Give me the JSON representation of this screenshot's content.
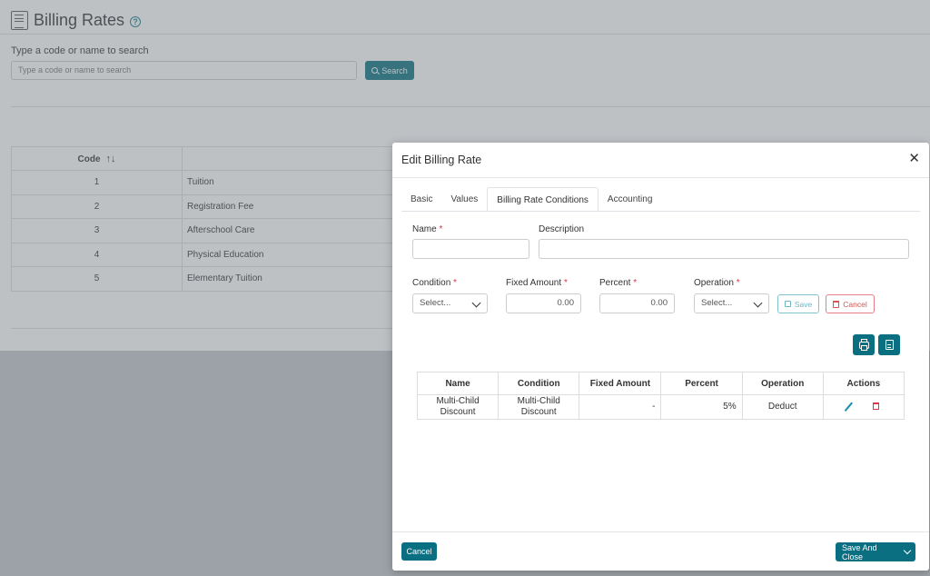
{
  "page": {
    "title": "Billing Rates",
    "search_label": "Type a code or name to search",
    "search_placeholder": "Type a code or name to search",
    "search_button": "Search",
    "table": {
      "code_header": "Code",
      "rows": [
        {
          "code": "1",
          "name": "Tuition"
        },
        {
          "code": "2",
          "name": "Registration Fee"
        },
        {
          "code": "3",
          "name": "Afterschool Care"
        },
        {
          "code": "4",
          "name": "Physical Education"
        },
        {
          "code": "5",
          "name": "Elementary Tuition"
        }
      ]
    }
  },
  "modal": {
    "title": "Edit Billing Rate",
    "close": "✕",
    "tabs": [
      "Basic",
      "Values",
      "Billing Rate Conditions",
      "Accounting"
    ],
    "active_tab": "Billing Rate Conditions",
    "form": {
      "name_label": "Name",
      "description_label": "Description",
      "condition_label": "Condition",
      "condition_value": "Select...",
      "fixed_amount_label": "Fixed Amount",
      "fixed_amount_value": "0.00",
      "percent_label": "Percent",
      "percent_value": "0.00",
      "operation_label": "Operation",
      "operation_value": "Select...",
      "required_mark": "*",
      "save_label": "Save",
      "cancel_label": "Cancel"
    },
    "conditions_table": {
      "headers": [
        "Name",
        "Condition",
        "Fixed Amount",
        "Percent",
        "Operation",
        "Actions"
      ],
      "rows": [
        {
          "name_line1": "Multi-Child",
          "name_line2": "Discount",
          "condition_line1": "Multi-Child",
          "condition_line2": "Discount",
          "fixed_amount": "-",
          "percent": "5%",
          "operation": "Deduct"
        }
      ]
    },
    "footer": {
      "cancel": "Cancel",
      "save_and_close": "Save And Close"
    }
  },
  "colors": {
    "primary": "#0b6f82",
    "danger": "#dc3545",
    "overlay": "#6c757d"
  },
  "icons": [
    "logo-icon",
    "help-icon",
    "search-icon",
    "sort-icon",
    "close-icon",
    "chevron-down-icon",
    "save-icon",
    "trash-icon",
    "printer-icon",
    "document-icon",
    "pencil-icon"
  ]
}
